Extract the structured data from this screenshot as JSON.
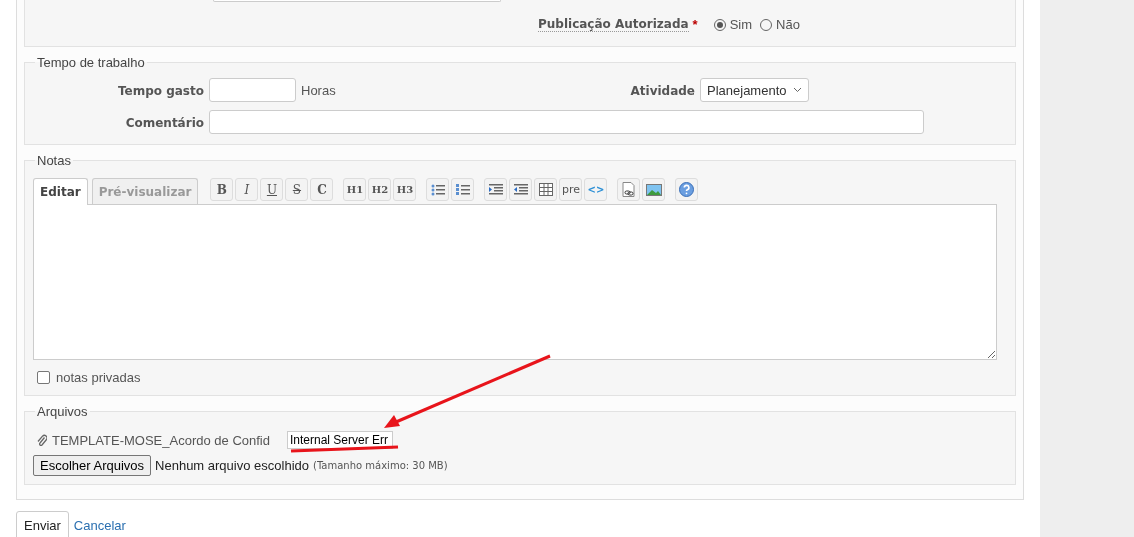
{
  "publication": {
    "label": "Publicação Autorizada",
    "required_mark": "*",
    "options": [
      {
        "label": "Sim",
        "selected": true
      },
      {
        "label": "Não",
        "selected": false
      }
    ]
  },
  "work_time": {
    "legend": "Tempo de trabalho",
    "time_label": "Tempo gasto",
    "time_unit": "Horas",
    "activity_label": "Atividade",
    "activity_value": "Planejamento",
    "comment_label": "Comentário"
  },
  "notes": {
    "legend": "Notas",
    "tabs": [
      {
        "label": "Editar",
        "selected": true
      },
      {
        "label": "Pré-visualizar",
        "selected": false
      }
    ],
    "toolbar": [
      [
        {
          "kind": "bold",
          "label": "B"
        },
        {
          "kind": "italic",
          "label": "I"
        },
        {
          "kind": "underline",
          "label": "U"
        },
        {
          "kind": "strike",
          "label": "S"
        },
        {
          "kind": "code",
          "label": "C"
        }
      ],
      [
        {
          "kind": "text",
          "label": "H1"
        },
        {
          "kind": "text",
          "label": "H2"
        },
        {
          "kind": "text",
          "label": "H3"
        }
      ],
      [
        {
          "kind": "bullet-list"
        },
        {
          "kind": "numbered-list"
        }
      ],
      [
        {
          "kind": "indent"
        },
        {
          "kind": "outdent"
        },
        {
          "kind": "table"
        },
        {
          "kind": "text",
          "label": "pre"
        },
        {
          "kind": "code-tag",
          "label": "<>"
        }
      ],
      [
        {
          "kind": "attachment"
        },
        {
          "kind": "image"
        }
      ],
      [
        {
          "kind": "help"
        }
      ]
    ],
    "private_label": "notas privadas",
    "private_checked": false
  },
  "files": {
    "legend": "Arquivos",
    "attachment_name": "TEMPLATE-MOSE_Acordo de Confid",
    "error_text": "Internal Server Err",
    "choose_button": "Escolher Arquivos",
    "no_file": "Nenhum arquivo escolhido",
    "max_size": "(Tamanho máximo: 30 MB)"
  },
  "actions": {
    "submit": "Enviar",
    "cancel": "Cancelar"
  }
}
